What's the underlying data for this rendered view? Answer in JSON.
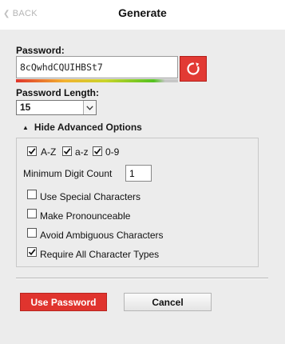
{
  "header": {
    "back_label": "BACK",
    "title": "Generate"
  },
  "password": {
    "label": "Password:",
    "value": "8cQwhdCQUIHBSt7",
    "strength_fraction": 0.92
  },
  "length": {
    "label": "Password Length:",
    "selected": "15"
  },
  "advanced": {
    "toggle_label": "Hide Advanced Options",
    "charset_az_upper": {
      "label": "A-Z",
      "checked": true
    },
    "charset_az_lower": {
      "label": "a-z",
      "checked": true
    },
    "charset_digits": {
      "label": "0-9",
      "checked": true
    },
    "min_digit_label": "Minimum Digit Count",
    "min_digit_value": "1",
    "options": [
      {
        "label": "Use Special Characters",
        "checked": false
      },
      {
        "label": "Make Pronounceable",
        "checked": false
      },
      {
        "label": "Avoid Ambiguous Characters",
        "checked": false
      },
      {
        "label": "Require All Character Types",
        "checked": true
      }
    ]
  },
  "actions": {
    "use_password_label": "Use Password",
    "cancel_label": "Cancel"
  },
  "colors": {
    "accent": "#e0342e",
    "background": "#ececec"
  },
  "icons": {
    "back": "chevron-left-icon",
    "regenerate": "refresh-icon",
    "dropdown": "chevron-down-icon",
    "toggle": "triangle-up-icon",
    "checkmark": "checkmark-icon"
  }
}
